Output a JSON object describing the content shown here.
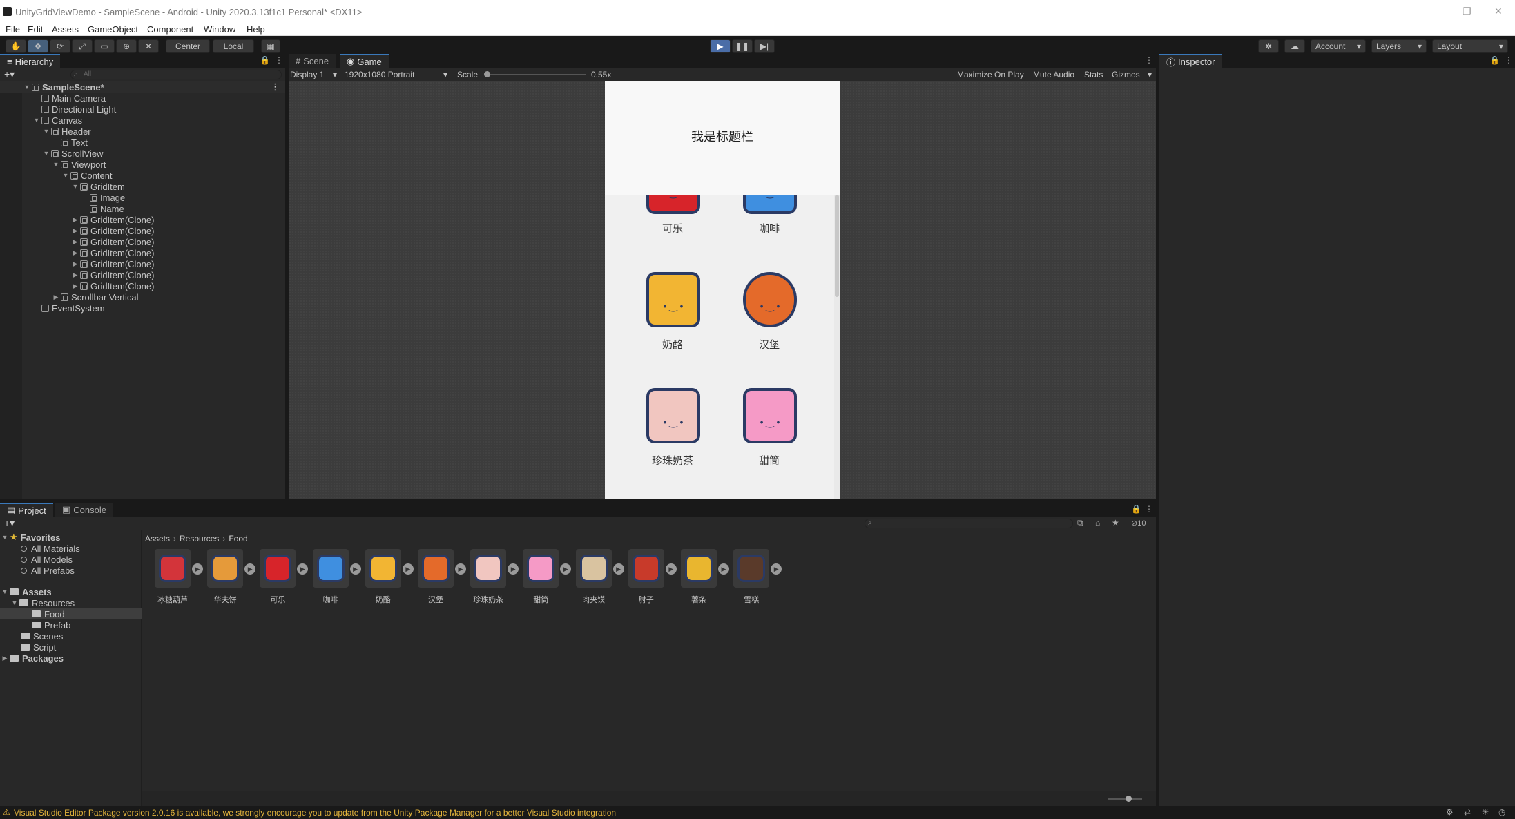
{
  "window": {
    "title": "UnityGridViewDemo - SampleScene - Android - Unity 2020.3.13f1c1 Personal* <DX11>"
  },
  "menu": [
    "File",
    "Edit",
    "Assets",
    "GameObject",
    "Component",
    "Window",
    "Help"
  ],
  "toolbar": {
    "pivot": "Center",
    "space": "Local",
    "account": "Account",
    "layers": "Layers",
    "layout": "Layout"
  },
  "hierarchy": {
    "tab": "Hierarchy",
    "search_placeholder": "All",
    "items": [
      {
        "label": "SampleScene*",
        "indent": 0,
        "expanded": true,
        "scene": true
      },
      {
        "label": "Main Camera",
        "indent": 1
      },
      {
        "label": "Directional Light",
        "indent": 1
      },
      {
        "label": "Canvas",
        "indent": 1,
        "expanded": true
      },
      {
        "label": "Header",
        "indent": 2,
        "expanded": true
      },
      {
        "label": "Text",
        "indent": 3
      },
      {
        "label": "ScrollView",
        "indent": 2,
        "expanded": true
      },
      {
        "label": "Viewport",
        "indent": 3,
        "expanded": true
      },
      {
        "label": "Content",
        "indent": 4,
        "expanded": true
      },
      {
        "label": "GridItem",
        "indent": 5,
        "expanded": true
      },
      {
        "label": "Image",
        "indent": 6
      },
      {
        "label": "Name",
        "indent": 6
      },
      {
        "label": "GridItem(Clone)",
        "indent": 5,
        "collapsed": true
      },
      {
        "label": "GridItem(Clone)",
        "indent": 5,
        "collapsed": true
      },
      {
        "label": "GridItem(Clone)",
        "indent": 5,
        "collapsed": true
      },
      {
        "label": "GridItem(Clone)",
        "indent": 5,
        "collapsed": true
      },
      {
        "label": "GridItem(Clone)",
        "indent": 5,
        "collapsed": true
      },
      {
        "label": "GridItem(Clone)",
        "indent": 5,
        "collapsed": true
      },
      {
        "label": "GridItem(Clone)",
        "indent": 5,
        "collapsed": true
      },
      {
        "label": "Scrollbar Vertical",
        "indent": 3,
        "collapsed": true
      },
      {
        "label": "EventSystem",
        "indent": 1
      }
    ]
  },
  "game": {
    "tabs": [
      "Scene",
      "Game"
    ],
    "display": "Display 1",
    "resolution": "1920x1080 Portrait",
    "scale_label": "Scale",
    "scale_value": "0.55x",
    "options": [
      "Maximize On Play",
      "Mute Audio",
      "Stats",
      "Gizmos"
    ],
    "header_title": "我是标题栏",
    "items": [
      {
        "name": "可乐",
        "icon": "cola-icon",
        "color": "#d7242a"
      },
      {
        "name": "咖啡",
        "icon": "coffee-icon",
        "color": "#3f8fe0"
      },
      {
        "name": "奶酪",
        "icon": "cheese-icon",
        "color": "#f2b533"
      },
      {
        "name": "汉堡",
        "icon": "burger-icon",
        "color": "#e46a2a"
      },
      {
        "name": "珍珠奶茶",
        "icon": "bubble-tea-icon",
        "color": "#f1c6c0"
      },
      {
        "name": "甜筒",
        "icon": "ice-cream-icon",
        "color": "#f59ac6"
      }
    ]
  },
  "inspector": {
    "tab": "Inspector"
  },
  "project": {
    "tabs": [
      "Project",
      "Console"
    ],
    "favorites": {
      "label": "Favorites",
      "items": [
        "All Materials",
        "All Models",
        "All Prefabs"
      ]
    },
    "assets": {
      "label": "Assets",
      "children": [
        "Resources",
        "Food",
        "Prefab",
        "Scenes",
        "Script"
      ]
    },
    "packages": "Packages",
    "breadcrumb": [
      "Assets",
      "Resources",
      "Food"
    ],
    "hidden_count": "10",
    "assets_list": [
      {
        "name": "冰糖葫芦",
        "icon": "candied-haws-icon",
        "color": "#d3343a"
      },
      {
        "name": "华夫饼",
        "icon": "waffle-icon",
        "color": "#e59a3a"
      },
      {
        "name": "可乐",
        "icon": "cola-icon",
        "color": "#d7242a"
      },
      {
        "name": "咖啡",
        "icon": "coffee-icon",
        "color": "#3f8fe0"
      },
      {
        "name": "奶酪",
        "icon": "cheese-icon",
        "color": "#f2b533"
      },
      {
        "name": "汉堡",
        "icon": "burger-icon",
        "color": "#e46a2a"
      },
      {
        "name": "珍珠奶茶",
        "icon": "bubble-tea-icon",
        "color": "#f1c6c0"
      },
      {
        "name": "甜筒",
        "icon": "ice-cream-icon",
        "color": "#f59ac6"
      },
      {
        "name": "肉夹馍",
        "icon": "roujiamo-icon",
        "color": "#d9c3a0"
      },
      {
        "name": "肘子",
        "icon": "pork-knuckle-icon",
        "color": "#c83a2a"
      },
      {
        "name": "薯条",
        "icon": "fries-icon",
        "color": "#e9b62f"
      },
      {
        "name": "雪糕",
        "icon": "popsicle-icon",
        "color": "#5a3a2a"
      }
    ]
  },
  "status": {
    "message": "Visual Studio Editor Package version 2.0.16 is available, we strongly encourage you to update from the Unity Package Manager for a better Visual Studio integration"
  }
}
